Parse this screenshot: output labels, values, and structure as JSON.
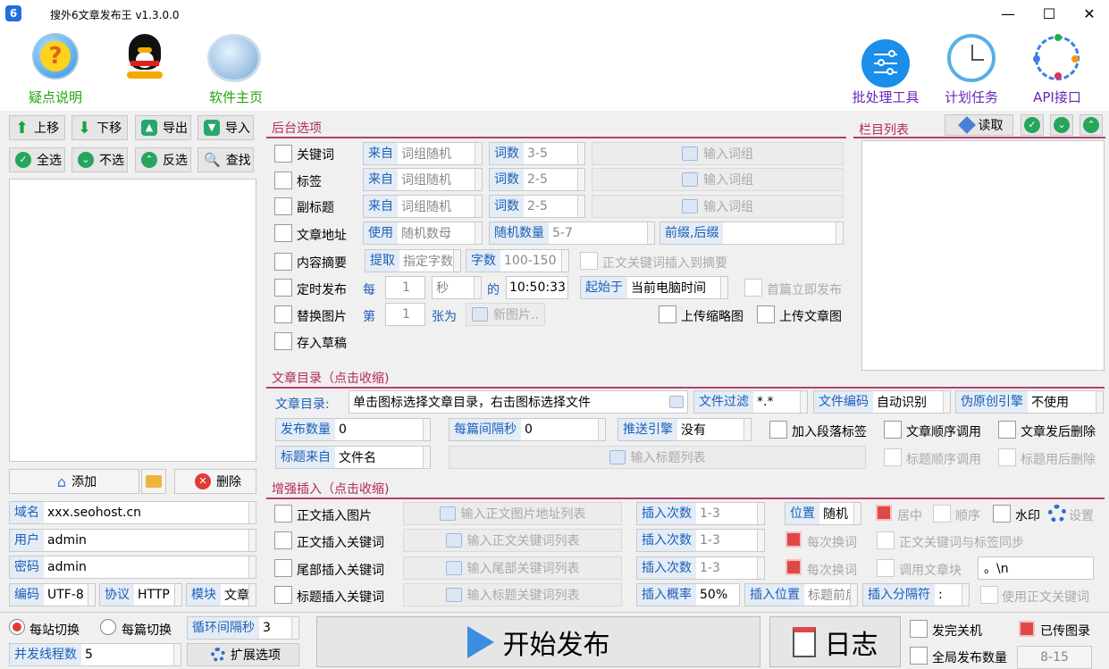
{
  "window": {
    "title": "搜外6文章发布王 v1.3.0.0",
    "app_icon": "6",
    "minimize": "—",
    "maximize": "☐",
    "close": "✕"
  },
  "toolbar": {
    "help": "疑点说明",
    "home": "软件主页",
    "batch": "批处理工具",
    "schedule": "计划任务",
    "api": "API接口"
  },
  "left": {
    "up": "上移",
    "down": "下移",
    "export": "导出",
    "import": "导入",
    "select_all": "全选",
    "select_none": "不选",
    "invert": "反选",
    "find": "查找",
    "add": "添加",
    "delete": "删除",
    "domain_label": "域名",
    "domain_value": "xxx.seohost.cn",
    "user_label": "用户",
    "user_value": "admin",
    "pwd_label": "密码",
    "pwd_value": "admin",
    "enc_label": "编码",
    "enc_value": "UTF-8",
    "proto_label": "协议",
    "proto_value": "HTTP",
    "module_label": "模块",
    "module_value": "文章"
  },
  "backend": {
    "title": "后台选项",
    "keyword": "关键词",
    "tag": "标签",
    "subtitle": "副标题",
    "url": "文章地址",
    "summary": "内容摘要",
    "timed": "定时发布",
    "replace_img": "替换图片",
    "draft": "存入草稿",
    "from": "来自",
    "from_val": "词组随机",
    "count": "词数",
    "kw_count": "3-5",
    "tag_count": "2-5",
    "sub_count": "2-5",
    "input_group": "输入词组",
    "use": "使用",
    "use_val": "随机数母",
    "rand_count": "随机数量",
    "rand_val": "5-7",
    "prefix": "前缀,后缀",
    "extract": "提取",
    "extract_val": "指定字数",
    "chars": "字数",
    "chars_val": "100-150",
    "insert_summary": "正文关键词插入到摘要",
    "every": "每",
    "every_val": "1",
    "unit": "秒",
    "of": "的",
    "time": "10:50:33",
    "start_from": "起始于",
    "start_val": "当前电脑时间",
    "first_now": "首篇立即发布",
    "nth": "第",
    "nth_val": "1",
    "as": "张为",
    "new_img": "新图片..",
    "upload_thumb": "上传缩略图",
    "upload_img": "上传文章图"
  },
  "category": {
    "title": "栏目列表",
    "read": "读取"
  },
  "dir": {
    "title": "文章目录（点击收缩)",
    "label": "文章目录:",
    "path": "单击图标选择文章目录，右击图标选择文件",
    "filter": "文件过滤",
    "filter_val": "*.*",
    "encoding": "文件编码",
    "encoding_val": "自动识别",
    "pseudo": "伪原创引擎",
    "pseudo_val": "不使用",
    "pub_count": "发布数量",
    "pub_count_val": "0",
    "interval": "每篇间隔秒",
    "interval_val": "0",
    "push": "推送引擎",
    "push_val": "没有",
    "para_tag": "加入段落标签",
    "order": "文章顺序调用",
    "del_after": "文章发后删除",
    "title_from": "标题来自",
    "title_from_val": "文件名",
    "title_list": "输入标题列表",
    "title_order": "标题顺序调用",
    "title_del": "标题用后删除"
  },
  "enhance": {
    "title": "增强插入（点击收缩)",
    "ins_img": "正文插入图片",
    "ins_kw": "正文插入关键词",
    "tail_kw": "尾部插入关键词",
    "title_kw": "标题插入关键词",
    "img_list": "输入正文图片地址列表",
    "kw_list": "输入正文关键词列表",
    "tail_list": "输入尾部关键词列表",
    "title_list": "输入标题关键词列表",
    "times": "插入次数",
    "times_val": "1-3",
    "prob": "插入概率",
    "prob_val": "50%",
    "position": "位置",
    "position_val": "随机",
    "center": "居中",
    "sequence": "顺序",
    "watermark": "水印",
    "settings": "设置",
    "each_swap": "每次换词",
    "sync": "正文关键词与标签同步",
    "call_block": "调用文章块",
    "block_val": "。\\n",
    "ins_pos": "插入位置",
    "ins_pos_val": "标题前后",
    "sep": "插入分隔符",
    "sep_val": ":",
    "use_body_kw": "使用正文关键词"
  },
  "bottom": {
    "per_site": "每站切换",
    "per_post": "每篇切换",
    "loop": "循环间隔秒",
    "loop_val": "3",
    "threads": "并发线程数",
    "threads_val": "5",
    "ext": "扩展选项",
    "start": "开始发布",
    "log": "日志",
    "shutdown": "发完关机",
    "sent_img": "已传图录",
    "global_count": "全局发布数量",
    "global_val": "8-15"
  }
}
